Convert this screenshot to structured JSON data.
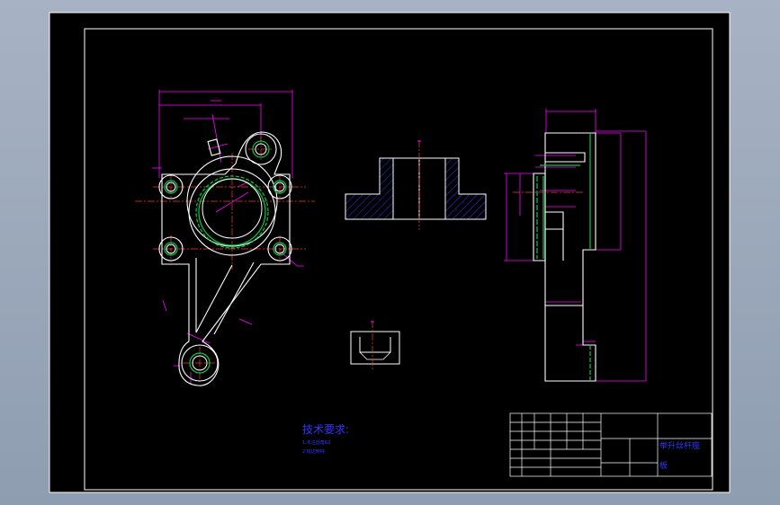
{
  "drawing": {
    "technical_requirements": {
      "title": "技术要求:",
      "lines": [
        "1.未注圆角R2",
        "2.锐边倒钝"
      ]
    },
    "title_block": {
      "part_name": "举升丝杆座",
      "part_name_line2": "板"
    },
    "colors": {
      "background": "#000000",
      "frame": "#ffffff",
      "dimension": "#ff00ff",
      "hatch": "#3333ff",
      "center_line": "#ff3333",
      "thread": "#00cc44",
      "text": "#3333ff"
    }
  }
}
